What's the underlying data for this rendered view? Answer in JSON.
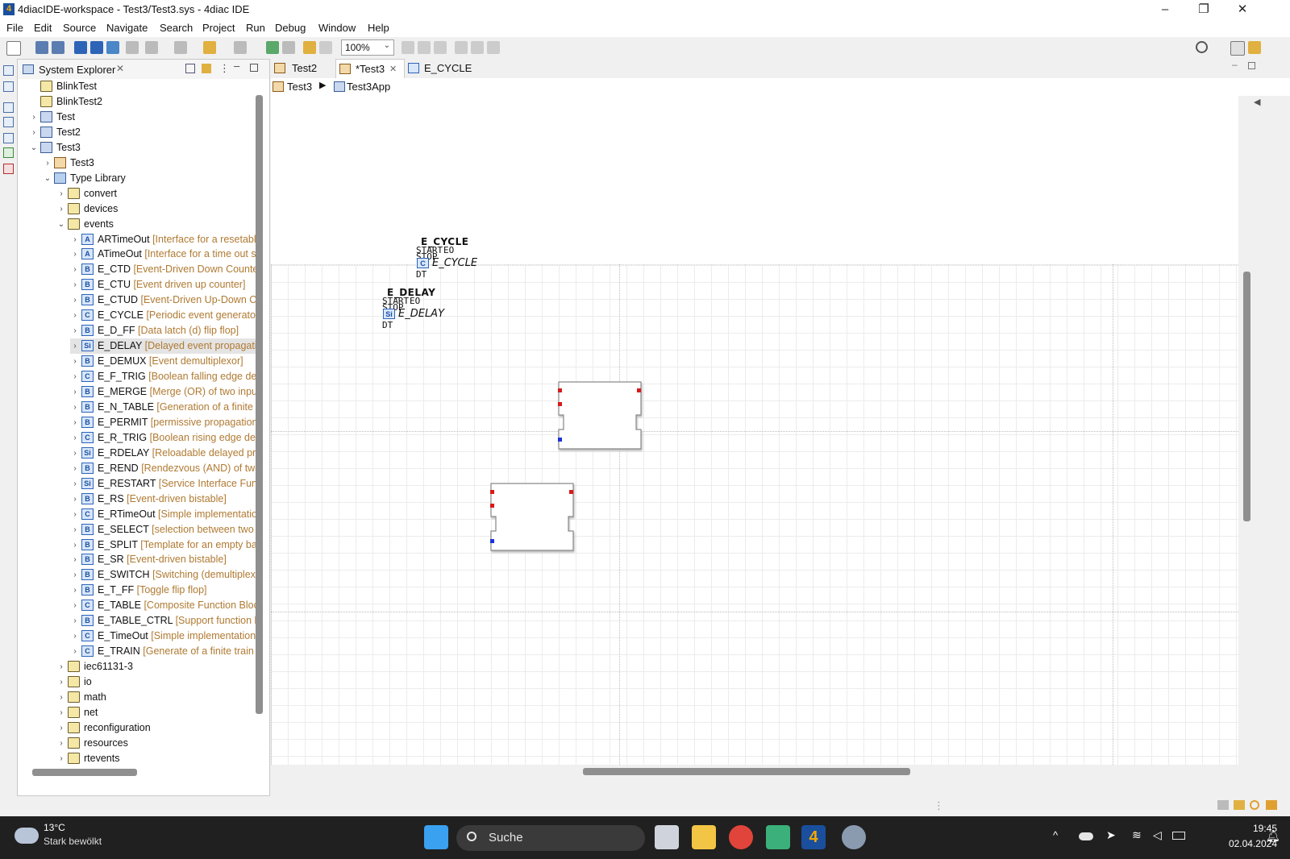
{
  "window": {
    "title": "4diacIDE-workspace - Test3/Test3.sys - 4diac IDE",
    "app_icon_label": "4",
    "minimize": "–",
    "maximize": "❐",
    "close": "✕"
  },
  "menu": [
    "File",
    "Edit",
    "Source",
    "Navigate",
    "Search",
    "Project",
    "Run",
    "Debug",
    "Window",
    "Help"
  ],
  "toolbar": {
    "zoom": "100%"
  },
  "explorer": {
    "title": "System Explorer",
    "tree": [
      {
        "label": "BlinkTest",
        "desc": "",
        "icon": "folder-icon",
        "depth": 0,
        "twisty": ""
      },
      {
        "label": "BlinkTest2",
        "desc": "",
        "icon": "folder-icon",
        "depth": 0,
        "twisty": ""
      },
      {
        "label": "Test",
        "desc": "",
        "icon": "project-icon",
        "depth": 0,
        "twisty": ">"
      },
      {
        "label": "Test2",
        "desc": "",
        "icon": "project-icon",
        "depth": 0,
        "twisty": ">"
      },
      {
        "label": "Test3",
        "desc": "",
        "icon": "project-icon",
        "depth": 0,
        "twisty": "v"
      },
      {
        "label": "Test3",
        "desc": "",
        "icon": "system-icon",
        "depth": 1,
        "twisty": ">"
      },
      {
        "label": "Type Library",
        "desc": "",
        "icon": "library-icon",
        "depth": 1,
        "twisty": "v"
      },
      {
        "label": "convert",
        "desc": "",
        "icon": "folder-icon",
        "depth": 2,
        "twisty": ">"
      },
      {
        "label": "devices",
        "desc": "",
        "icon": "folder-icon",
        "depth": 2,
        "twisty": ">"
      },
      {
        "label": "events",
        "desc": "",
        "icon": "folder-icon",
        "depth": 2,
        "twisty": "v"
      },
      {
        "label": "ARTimeOut",
        "desc": "[Interface for a resetable",
        "icon": "A",
        "depth": 3,
        "twisty": ">"
      },
      {
        "label": "ATimeOut",
        "desc": "[Interface for a time out s",
        "icon": "A",
        "depth": 3,
        "twisty": ">"
      },
      {
        "label": "E_CTD",
        "desc": "[Event-Driven Down Counter",
        "icon": "B",
        "depth": 3,
        "twisty": ">"
      },
      {
        "label": "E_CTU",
        "desc": "[Event driven up counter]",
        "icon": "B",
        "depth": 3,
        "twisty": ">"
      },
      {
        "label": "E_CTUD",
        "desc": "[Event-Driven Up-Down Co",
        "icon": "B",
        "depth": 3,
        "twisty": ">"
      },
      {
        "label": "E_CYCLE",
        "desc": "[Periodic event generator]",
        "icon": "C",
        "depth": 3,
        "twisty": ">"
      },
      {
        "label": "E_D_FF",
        "desc": "[Data latch (d) flip flop]",
        "icon": "B",
        "depth": 3,
        "twisty": ">"
      },
      {
        "label": "E_DELAY",
        "desc": "[Delayed event propagation",
        "icon": "Si",
        "depth": 3,
        "twisty": ">",
        "selected": true
      },
      {
        "label": "E_DEMUX",
        "desc": "[Event demultiplexor]",
        "icon": "B",
        "depth": 3,
        "twisty": ">"
      },
      {
        "label": "E_F_TRIG",
        "desc": "[Boolean falling edge dete",
        "icon": "C",
        "depth": 3,
        "twisty": ">"
      },
      {
        "label": "E_MERGE",
        "desc": "[Merge (OR) of two input e",
        "icon": "B",
        "depth": 3,
        "twisty": ">"
      },
      {
        "label": "E_N_TABLE",
        "desc": "[Generation of a finite tra",
        "icon": "B",
        "depth": 3,
        "twisty": ">"
      },
      {
        "label": "E_PERMIT",
        "desc": "[permissive propagation c",
        "icon": "B",
        "depth": 3,
        "twisty": ">"
      },
      {
        "label": "E_R_TRIG",
        "desc": "[Boolean rising edge detec",
        "icon": "C",
        "depth": 3,
        "twisty": ">"
      },
      {
        "label": "E_RDELAY",
        "desc": "[Reloadable delayed prop",
        "icon": "Si",
        "depth": 3,
        "twisty": ">"
      },
      {
        "label": "E_REND",
        "desc": "[Rendezvous (AND) of two e",
        "icon": "B",
        "depth": 3,
        "twisty": ">"
      },
      {
        "label": "E_RESTART",
        "desc": "[Service Interface Functic",
        "icon": "Si",
        "depth": 3,
        "twisty": ">"
      },
      {
        "label": "E_RS",
        "desc": "[Event-driven bistable]",
        "icon": "B",
        "depth": 3,
        "twisty": ">"
      },
      {
        "label": "E_RTimeOut",
        "desc": "[Simple implementation",
        "icon": "C",
        "depth": 3,
        "twisty": ">"
      },
      {
        "label": "E_SELECT",
        "desc": "[selection between two ev",
        "icon": "B",
        "depth": 3,
        "twisty": ">"
      },
      {
        "label": "E_SPLIT",
        "desc": "[Template for an empty basi",
        "icon": "B",
        "depth": 3,
        "twisty": ">"
      },
      {
        "label": "E_SR",
        "desc": "[Event-driven bistable]",
        "icon": "B",
        "depth": 3,
        "twisty": ">"
      },
      {
        "label": "E_SWITCH",
        "desc": "[Switching (demultiplexin",
        "icon": "B",
        "depth": 3,
        "twisty": ">"
      },
      {
        "label": "E_T_FF",
        "desc": "[Toggle flip flop]",
        "icon": "B",
        "depth": 3,
        "twisty": ">"
      },
      {
        "label": "E_TABLE",
        "desc": "[Composite Function Block",
        "icon": "C",
        "depth": 3,
        "twisty": ">"
      },
      {
        "label": "E_TABLE_CTRL",
        "desc": "[Support function blo",
        "icon": "B",
        "depth": 3,
        "twisty": ">"
      },
      {
        "label": "E_TimeOut",
        "desc": "[Simple implementation",
        "icon": "C",
        "depth": 3,
        "twisty": ">"
      },
      {
        "label": "E_TRAIN",
        "desc": "[Generate of a finite train o",
        "icon": "C",
        "depth": 3,
        "twisty": ">"
      },
      {
        "label": "iec61131-3",
        "desc": "",
        "icon": "folder-icon",
        "depth": 2,
        "twisty": ">"
      },
      {
        "label": "io",
        "desc": "",
        "icon": "folder-icon",
        "depth": 2,
        "twisty": ">"
      },
      {
        "label": "math",
        "desc": "",
        "icon": "folder-icon",
        "depth": 2,
        "twisty": ">"
      },
      {
        "label": "net",
        "desc": "",
        "icon": "folder-icon",
        "depth": 2,
        "twisty": ">"
      },
      {
        "label": "reconfiguration",
        "desc": "",
        "icon": "folder-icon",
        "depth": 2,
        "twisty": ">"
      },
      {
        "label": "resources",
        "desc": "",
        "icon": "folder-icon",
        "depth": 2,
        "twisty": ">"
      },
      {
        "label": "rtevents",
        "desc": "",
        "icon": "folder-icon",
        "depth": 2,
        "twisty": ">"
      }
    ]
  },
  "editor": {
    "tabs": [
      {
        "label": "Test2",
        "active": false
      },
      {
        "label": "*Test3",
        "active": true
      },
      {
        "label": "E_CYCLE",
        "active": false
      }
    ],
    "breadcrumb": [
      "Test3",
      "Test3App"
    ],
    "blocks": [
      {
        "name": "E_CYCLE",
        "type": "E_CYCLE",
        "icon": "C",
        "event_in": [
          "START",
          "STOP"
        ],
        "event_out": [
          "EO"
        ],
        "data_in": [
          "DT"
        ]
      },
      {
        "name": "E_DELAY",
        "type": "E_DELAY",
        "icon": "Si",
        "event_in": [
          "START",
          "STOP"
        ],
        "event_out": [
          "EO"
        ],
        "data_in": [
          "DT"
        ]
      }
    ]
  },
  "taskbar": {
    "weather_temp": "13°C",
    "weather_desc": "Stark bewölkt",
    "search_placeholder": "Suche",
    "time": "19:45",
    "date": "02.04.2024"
  },
  "colors": {
    "event_pin": "#d81a1a",
    "data_pin": "#1a32d8",
    "tree_description": "#b07a32"
  }
}
